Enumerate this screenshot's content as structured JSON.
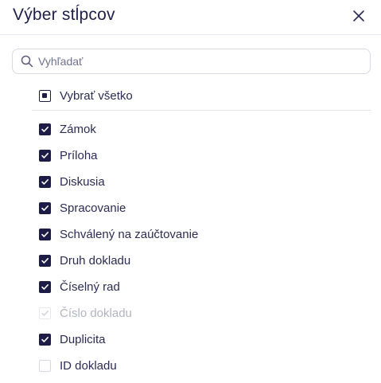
{
  "dialog": {
    "title": "Výber stĺpcov",
    "close_icon": "close-icon"
  },
  "search": {
    "placeholder": "Vyhľadať",
    "value": "",
    "icon": "search-icon"
  },
  "select_all": {
    "label": "Vybrať všetko",
    "state": "indeterminate"
  },
  "columns": [
    {
      "label": "Zámok",
      "state": "checked"
    },
    {
      "label": "Príloha",
      "state": "checked"
    },
    {
      "label": "Diskusia",
      "state": "checked"
    },
    {
      "label": "Spracovanie",
      "state": "checked"
    },
    {
      "label": "Schválený na zaúčtovanie",
      "state": "checked"
    },
    {
      "label": "Druh dokladu",
      "state": "checked"
    },
    {
      "label": "Číselný rad",
      "state": "checked"
    },
    {
      "label": "Číslo dokladu",
      "state": "disabled-checked"
    },
    {
      "label": "Duplicita",
      "state": "checked"
    },
    {
      "label": "ID dokladu",
      "state": "unchecked"
    }
  ],
  "colors": {
    "accent": "#1c1c47",
    "text": "#2b2b55",
    "disabled_text": "#b3b4c2",
    "border": "#d9dbe3"
  }
}
